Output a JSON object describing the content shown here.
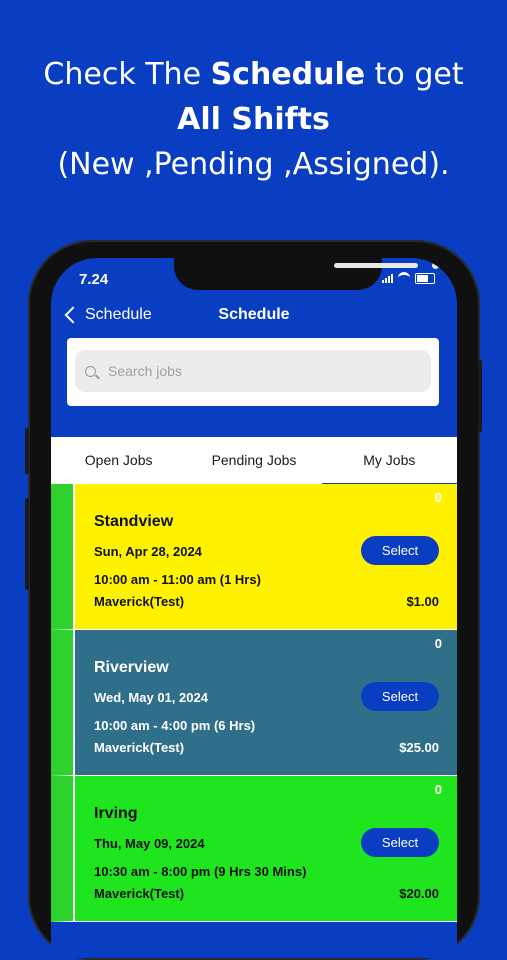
{
  "promo": {
    "line1_pre": "Check The ",
    "line1_bold": "Schedule",
    "line1_post": " to get",
    "line2_bold": "All Shifts",
    "line3": "(New ,Pending ,Assigned)."
  },
  "status_bar": {
    "time": "7.24"
  },
  "nav": {
    "back_label": "Schedule",
    "title": "Schedule"
  },
  "search": {
    "placeholder": "Search jobs",
    "value": ""
  },
  "tabs": [
    {
      "label": "Open Jobs",
      "active": false
    },
    {
      "label": "Pending Jobs",
      "active": false
    },
    {
      "label": "My Jobs",
      "active": true
    }
  ],
  "jobs": [
    {
      "name": "Standview",
      "date": "Sun, Apr 28, 2024",
      "time": "10:00 am - 11:00 am (1 Hrs)",
      "client": "Maverick(Test)",
      "price": "$1.00",
      "count": "0",
      "button": "Select",
      "bg": "#fff200",
      "text_color": "#111111"
    },
    {
      "name": "Riverview",
      "date": "Wed, May 01, 2024",
      "time": "10:00 am - 4:00 pm (6 Hrs)",
      "client": "Maverick(Test)",
      "price": "$25.00",
      "count": "0",
      "button": "Select",
      "bg": "#2f6f8a",
      "text_color": "#ffffff"
    },
    {
      "name": "Irving",
      "date": "Thu, May 09, 2024",
      "time": "10:30 am - 8:00 pm (9 Hrs 30 Mins)",
      "client": "Maverick(Test)",
      "price": "$20.00",
      "count": "0",
      "button": "Select",
      "bg": "#1fe51f",
      "text_color": "#111111"
    }
  ],
  "colors": {
    "background": "#0a3ec2",
    "accent_bar": "#2fd12f"
  }
}
